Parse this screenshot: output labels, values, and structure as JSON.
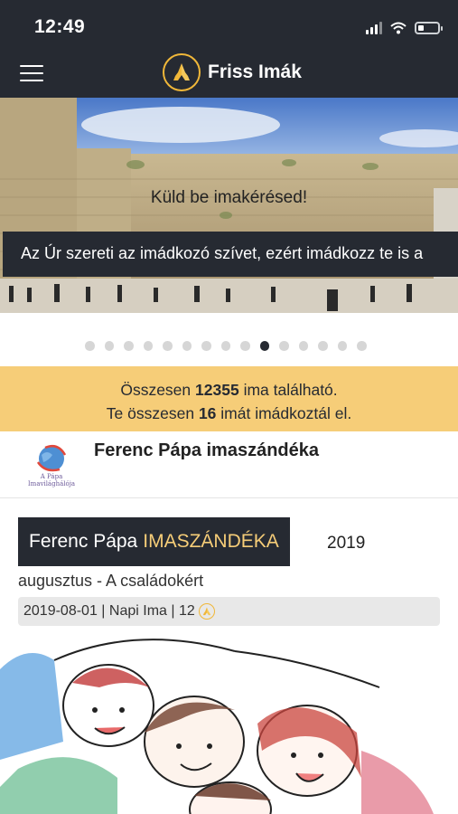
{
  "status_bar": {
    "time": "12:49",
    "icons": [
      "signal-icon",
      "wifi-icon",
      "battery-icon"
    ],
    "battery_level": 0.3
  },
  "app_bar": {
    "menu_icon": "hamburger-menu-icon",
    "logo_icon": "praying-hands-icon",
    "title": "Friss Imák"
  },
  "banner": {
    "heading": "Küld be imakérésed!",
    "message": "Az Úr szereti az imádkozó szívet, ezért imádkozz te is a",
    "image": "western-wall-photo"
  },
  "carousel": {
    "dot_count": 15,
    "active_index": 9
  },
  "stats": {
    "line1_prefix": "Összesen",
    "line1_count": "12355",
    "line1_suffix": "ima található.",
    "line2_prefix": "Te összesen",
    "line2_count": "16",
    "line2_suffix": "imát imádkoztál el."
  },
  "intention_section": {
    "logo_caption": "A Pápa Imavilághálója",
    "title": "Ferenc Pápa imaszándéka"
  },
  "article": {
    "badge_white": "Ferenc Pápa",
    "badge_yellow": "IMASZÁNDÉKA",
    "year": "2019",
    "subtitle": "augusztus - A családokért",
    "meta": "2019-08-01 | Napi Ima | 12",
    "meta_icon": "praying-hands-icon",
    "illustration": "family-watercolor-illustration"
  },
  "colors": {
    "dark": "#262a32",
    "accent": "#f6cd78",
    "logo_ring": "#f0b739"
  }
}
